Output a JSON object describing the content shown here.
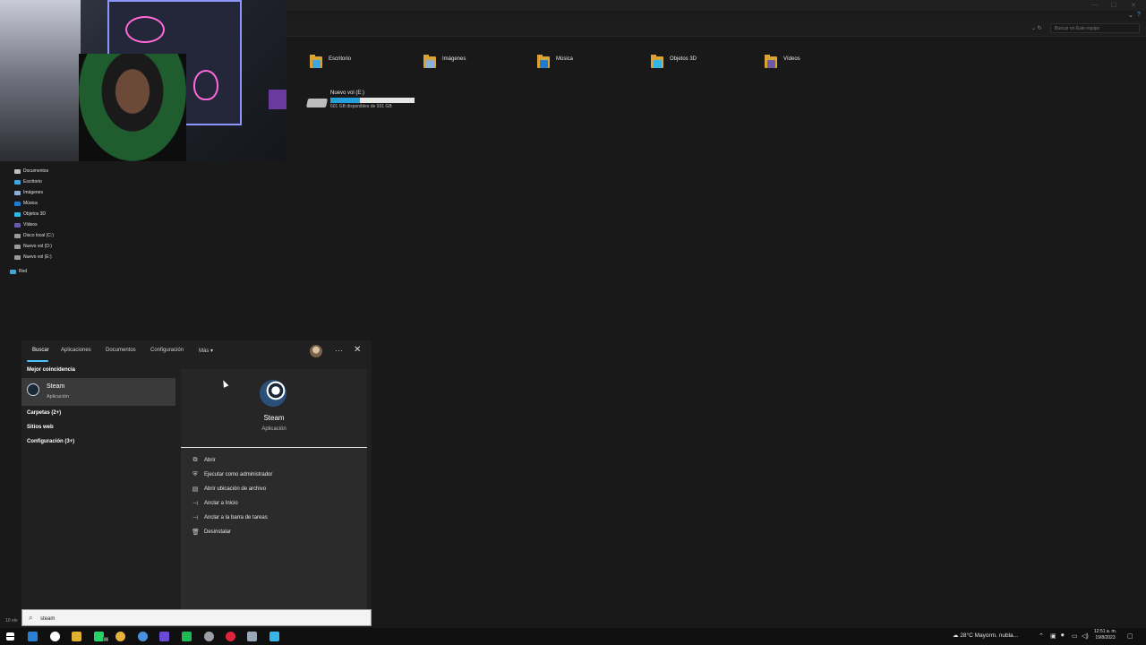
{
  "explorer": {
    "search_placeholder": "Buscar en Este equipo",
    "folders": [
      {
        "label": "Escritorio",
        "overlay": "#3ea6e0"
      },
      {
        "label": "Imágenes",
        "overlay": "#8fb0d6"
      },
      {
        "label": "Música",
        "overlay": "#1f7bd0"
      },
      {
        "label": "Objetos 3D",
        "overlay": "#32b6e6"
      },
      {
        "label": "Vídeos",
        "overlay": "#6b5aa8"
      }
    ],
    "drive": {
      "name": "Nuevo vol (E:)",
      "free_text": "601 GB disponibles de 931 GB",
      "used_fraction": 0.35
    },
    "sidebar": [
      {
        "label": "Documentos",
        "icon": "documents-icon",
        "color": "#bfbfbf"
      },
      {
        "label": "Escritorio",
        "icon": "desktop-icon",
        "color": "#3ea6e0"
      },
      {
        "label": "Imágenes",
        "icon": "pictures-icon",
        "color": "#8fb0d6"
      },
      {
        "label": "Música",
        "icon": "music-icon",
        "color": "#1f7bd0"
      },
      {
        "label": "Objetos 3D",
        "icon": "objects3d-icon",
        "color": "#32b6e6"
      },
      {
        "label": "Vídeos",
        "icon": "videos-icon",
        "color": "#6b5aa8"
      },
      {
        "label": "Disco local (C:)",
        "icon": "drive-icon",
        "color": "#9a9a9a"
      },
      {
        "label": "Nuevo vol (D:)",
        "icon": "drive-icon",
        "color": "#9a9a9a"
      },
      {
        "label": "Nuevo vol (E:)",
        "icon": "drive-icon",
        "color": "#9a9a9a"
      },
      {
        "label": "Red",
        "icon": "network-icon",
        "color": "#3ea6e0"
      }
    ],
    "status": "10 ele"
  },
  "search_panel": {
    "tabs": [
      "Buscar",
      "Aplicaciones",
      "Documentos",
      "Configuración",
      "Más"
    ],
    "best_match_header": "Mejor coincidencia",
    "best_match": {
      "name": "Steam",
      "type": "Aplicación"
    },
    "sections": [
      "Carpetas (2+)",
      "Sitios web",
      "Configuración (3+)"
    ],
    "detail": {
      "name": "Steam",
      "type": "Aplicación"
    },
    "actions": [
      {
        "label": "Abrir",
        "icon": "open-icon"
      },
      {
        "label": "Ejecutar como administrador",
        "icon": "run-as-admin-icon"
      },
      {
        "label": "Abrir ubicación de archivo",
        "icon": "file-location-icon"
      },
      {
        "label": "Anclar a Inicio",
        "icon": "pin-start-icon"
      },
      {
        "label": "Anclar a la barra de tareas",
        "icon": "pin-taskbar-icon"
      },
      {
        "label": "Desinstalar",
        "icon": "uninstall-icon"
      }
    ],
    "query": "steam"
  },
  "taskbar": {
    "apps": [
      {
        "name": "file-explorer-icon",
        "color": "#2a7fd6"
      },
      {
        "name": "clock-app-icon",
        "color": "#ffffff"
      },
      {
        "name": "folder-app-icon",
        "color": "#e0b030"
      },
      {
        "name": "whatsapp-icon",
        "color": "#25d366"
      },
      {
        "name": "chrome-icon",
        "color": "#e8b23a"
      },
      {
        "name": "chrome-profile-icon",
        "color": "#4a8fe0"
      },
      {
        "name": "app-purple-icon",
        "color": "#6b4bd6"
      },
      {
        "name": "spotify-icon",
        "color": "#1db954"
      },
      {
        "name": "chrome-alt-icon",
        "color": "#9aa0a6"
      },
      {
        "name": "opera-icon",
        "color": "#e0243b"
      },
      {
        "name": "steam-taskbar-icon",
        "color": "#9aa8b5"
      },
      {
        "name": "taskbar-app-icon",
        "color": "#36b6e8"
      }
    ],
    "whatsapp_badge": "23",
    "weather": "28°C  Mayorm. nubla...",
    "time": "12:51 a. m.",
    "date": "19/8/2023"
  }
}
